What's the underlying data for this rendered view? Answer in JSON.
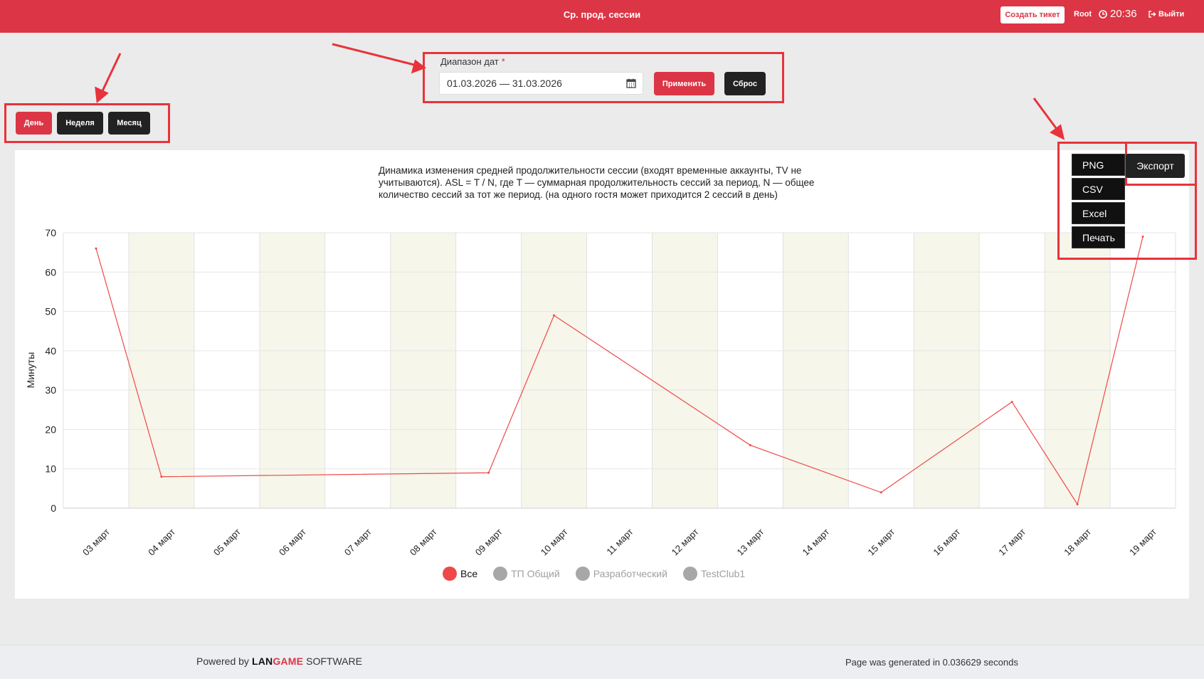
{
  "header": {
    "title": "Ср. прод. сессии",
    "create_ticket": "Создать тикет",
    "user": "Root",
    "time": "20:36",
    "logout": "Выйти"
  },
  "date_range": {
    "label": "Диапазон дат",
    "required_mark": "*",
    "value": "01.03.2026 — 31.03.2026",
    "apply": "Применить",
    "reset": "Сброс"
  },
  "period": {
    "day": "День",
    "week": "Неделя",
    "month": "Месяц",
    "active": "day"
  },
  "export": {
    "button": "Экспорт",
    "options": [
      "PNG",
      "CSV",
      "Excel",
      "Печать"
    ]
  },
  "chart_title": "Динамика изменения средней продолжительности сессии (входят временные аккаунты, TV не учитываются). ASL = T / N, где T — суммарная продолжительность сессий за период, N — общее количество сессий за тот же период. (на одного гостя может приходится 2 сессий в день)",
  "chart_data": {
    "type": "line",
    "title": "Динамика изменения средней продолжительности сессии (входят временные аккаунты, TV не учитываются). ASL = T / N, где T — суммарная продолжительность сессий за период, N — общее количество сессий за тот же период. (на одного гостя может приходится 2 сессий в день)",
    "xlabel": "",
    "ylabel": "Минуты",
    "ylim": [
      0,
      70
    ],
    "yticks": [
      0,
      10,
      20,
      30,
      40,
      50,
      60,
      70
    ],
    "categories": [
      "03 март",
      "04 март",
      "05 март",
      "06 март",
      "07 март",
      "08 март",
      "09 март",
      "10 март",
      "11 март",
      "12 март",
      "13 март",
      "14 март",
      "15 март",
      "16 март",
      "17 март",
      "18 март",
      "19 март"
    ],
    "series": [
      {
        "name": "Все",
        "color": "#f04848",
        "points": [
          {
            "x": "03 март",
            "y": 66
          },
          {
            "x": "04 март",
            "y": 8
          },
          {
            "x": "09 март",
            "y": 9
          },
          {
            "x": "10 март",
            "y": 49
          },
          {
            "x": "13 март",
            "y": 16
          },
          {
            "x": "15 март",
            "y": 4
          },
          {
            "x": "17 март",
            "y": 27
          },
          {
            "x": "18 март",
            "y": 1
          },
          {
            "x": "19 март",
            "y": 69
          }
        ]
      }
    ],
    "legend": [
      "Все",
      "ТП Общий",
      "Разработческий",
      "TestClub1"
    ],
    "legend_placement": "bottom",
    "grid": true,
    "band_color": "#f6f6ea"
  },
  "footer": {
    "powered_by": "Powered by",
    "brand_lan": "LAN",
    "brand_game": "GAME",
    "brand_software": "SOFTWARE",
    "generated": "Page was generated in 0.036629 seconds"
  },
  "colors": {
    "accent": "#dc3545",
    "dark_button": "#222222",
    "annotation": "#e8333b"
  }
}
